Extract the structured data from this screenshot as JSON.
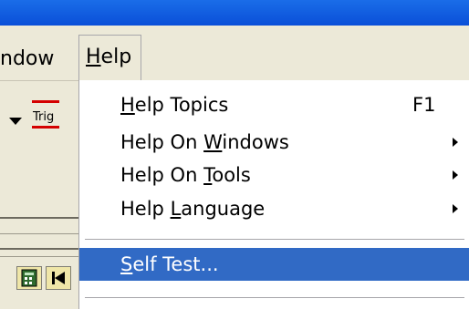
{
  "menubar": {
    "window_label": "ndow",
    "help_label": "Help",
    "help_mnemonic": "H",
    "help_rest": "elp"
  },
  "toolbar": {
    "trig_label": "Trig"
  },
  "help_menu": {
    "items": [
      {
        "mn": "H",
        "rest": "elp Topics",
        "shortcut": "F1",
        "submenu": false
      },
      {
        "pre": "Help On ",
        "mn": "W",
        "rest": "indows",
        "submenu": true
      },
      {
        "pre": "Help On ",
        "mn": "T",
        "rest": "ools",
        "submenu": true
      },
      {
        "pre": "Help ",
        "mn": "L",
        "rest": "anguage",
        "submenu": true
      },
      {
        "mn": "S",
        "rest": "elf Test...",
        "submenu": false,
        "highlighted": true
      }
    ]
  },
  "colors": {
    "highlight": "#316ac5",
    "titlebar": "#0a4fd8",
    "face": "#ece9d8"
  }
}
